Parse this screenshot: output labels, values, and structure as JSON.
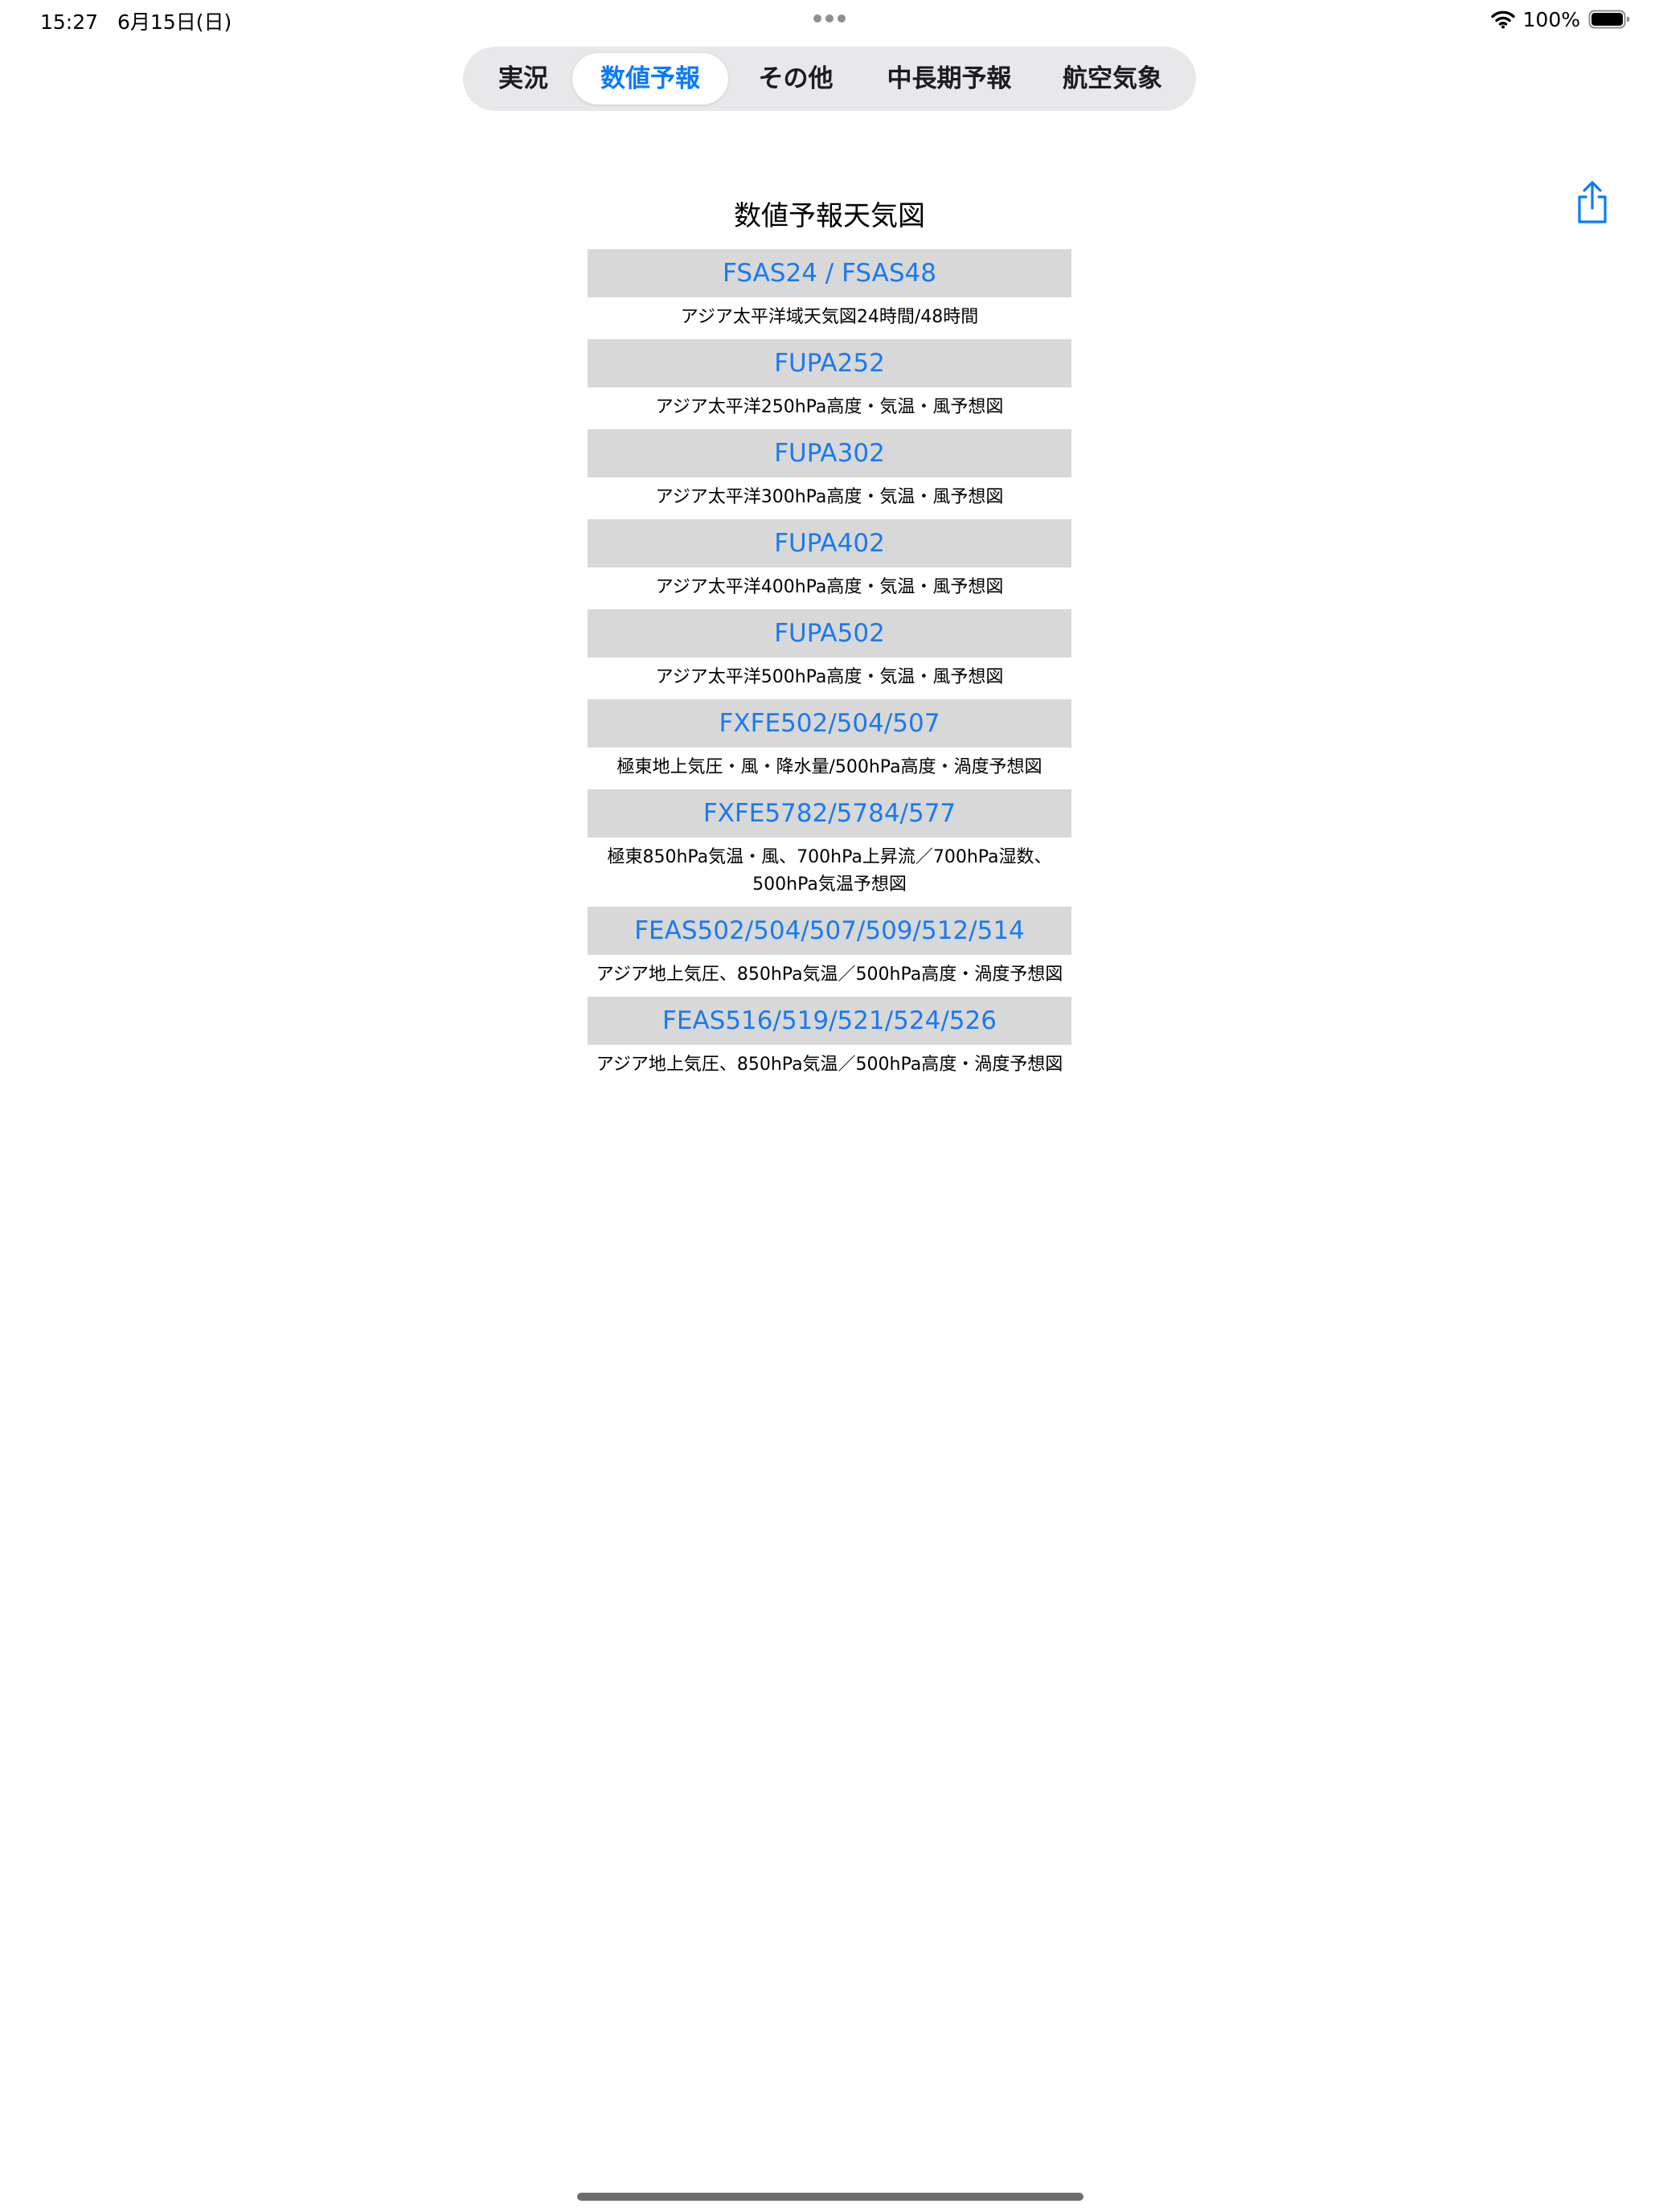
{
  "status_bar": {
    "time": "15:27",
    "date": "6月15日(日)",
    "battery": "100%"
  },
  "tabs": [
    {
      "label": "実況"
    },
    {
      "label": "数値予報"
    },
    {
      "label": "その他"
    },
    {
      "label": "中長期予報"
    },
    {
      "label": "航空気象"
    }
  ],
  "selected_tab": "数値予報",
  "page": {
    "title": "数値予報天気図"
  },
  "charts": [
    {
      "code": "FSAS24 / FSAS48",
      "description": "アジア太平洋域天気図24時間/48時間"
    },
    {
      "code": "FUPA252",
      "description": "アジア太平洋250hPa高度・気温・風予想図"
    },
    {
      "code": "FUPA302",
      "description": "アジア太平洋300hPa高度・気温・風予想図"
    },
    {
      "code": "FUPA402",
      "description": "アジア太平洋400hPa高度・気温・風予想図"
    },
    {
      "code": "FUPA502",
      "description": "アジア太平洋500hPa高度・気温・風予想図"
    },
    {
      "code": "FXFE502/504/507",
      "description": "極東地上気圧・風・降水量/500hPa高度・渦度予想図"
    },
    {
      "code": "FXFE5782/5784/577",
      "description": "極東850hPa気温・風、700hPa上昇流／700hPa湿数、\n500hPa気温予想図"
    },
    {
      "code": "FEAS502/504/507/509/512/514",
      "description": "アジア地上気圧、850hPa気温／500hPa高度・渦度予想図"
    },
    {
      "code": "FEAS516/519/521/524/526",
      "description": "アジア地上気圧、850hPa気温／500hPa高度・渦度予想図"
    }
  ],
  "icons": {
    "share": "share-icon",
    "wifi": "wifi-icon",
    "battery": "battery-icon",
    "multitask": "multitask-dots-icon"
  },
  "colors": {
    "accent": "#0a7aff",
    "link": "#1a7af0",
    "link_background": "#d8d8d8",
    "segmented_background": "#e8e8ea"
  }
}
